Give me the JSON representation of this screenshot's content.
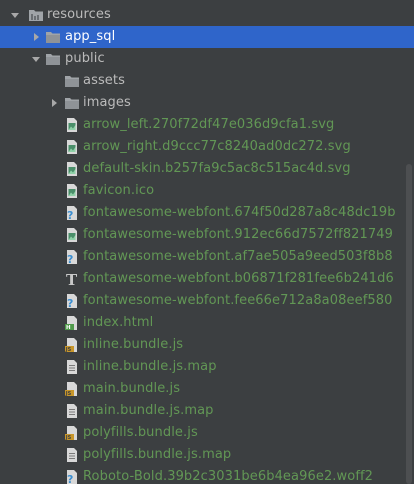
{
  "tree": {
    "items": [
      {
        "label": "resources",
        "kind": "folder",
        "expanded": true,
        "depth": 0,
        "icon": "folder-resources-icon"
      },
      {
        "label": "app_sql",
        "kind": "folder",
        "expanded": false,
        "depth": 1,
        "selected": true,
        "icon": "folder-icon"
      },
      {
        "label": "public",
        "kind": "folder",
        "expanded": true,
        "depth": 1,
        "icon": "folder-icon"
      },
      {
        "label": "assets",
        "kind": "folder",
        "expanded": null,
        "depth": 2,
        "icon": "folder-icon"
      },
      {
        "label": "images",
        "kind": "folder",
        "expanded": false,
        "depth": 2,
        "icon": "folder-icon"
      },
      {
        "label": "arrow_left.270f72df47e036d9cfa1.svg",
        "kind": "file",
        "depth": 2,
        "icon": "image-file-icon"
      },
      {
        "label": "arrow_right.d9ccc77c8240ad0dc272.svg",
        "kind": "file",
        "depth": 2,
        "icon": "image-file-icon"
      },
      {
        "label": "default-skin.b257fa9c5ac8c515ac4d.svg",
        "kind": "file",
        "depth": 2,
        "icon": "image-file-icon"
      },
      {
        "label": "favicon.ico",
        "kind": "file",
        "depth": 2,
        "icon": "image-file-icon"
      },
      {
        "label": "fontawesome-webfont.674f50d287a8c48dc19b",
        "kind": "file",
        "depth": 2,
        "icon": "unknown-file-icon"
      },
      {
        "label": "fontawesome-webfont.912ec66d7572ff821749",
        "kind": "file",
        "depth": 2,
        "icon": "image-file-icon"
      },
      {
        "label": "fontawesome-webfont.af7ae505a9eed503f8b8",
        "kind": "file",
        "depth": 2,
        "icon": "unknown-file-icon"
      },
      {
        "label": "fontawesome-webfont.b06871f281fee6b241d6",
        "kind": "file",
        "depth": 2,
        "icon": "font-file-icon"
      },
      {
        "label": "fontawesome-webfont.fee66e712a8a08eef580",
        "kind": "file",
        "depth": 2,
        "icon": "unknown-file-icon"
      },
      {
        "label": "index.html",
        "kind": "file",
        "depth": 2,
        "icon": "html-file-icon"
      },
      {
        "label": "inline.bundle.js",
        "kind": "file",
        "depth": 2,
        "icon": "js-file-icon"
      },
      {
        "label": "inline.bundle.js.map",
        "kind": "file",
        "depth": 2,
        "icon": "text-file-icon"
      },
      {
        "label": "main.bundle.js",
        "kind": "file",
        "depth": 2,
        "icon": "js-file-icon"
      },
      {
        "label": "main.bundle.js.map",
        "kind": "file",
        "depth": 2,
        "icon": "text-file-icon"
      },
      {
        "label": "polyfills.bundle.js",
        "kind": "file",
        "depth": 2,
        "icon": "js-file-icon"
      },
      {
        "label": "polyfills.bundle.js.map",
        "kind": "file",
        "depth": 2,
        "icon": "text-file-icon"
      },
      {
        "label": "Roboto-Bold.39b2c3031be6b4ea96e2.woff2",
        "kind": "file",
        "depth": 2,
        "icon": "unknown-file-icon"
      }
    ]
  },
  "colors": {
    "background": "#3c3f41",
    "selection": "#2f65ca",
    "folder_text": "#bbbbbb",
    "file_text": "#629755",
    "selected_text": "#ffffff"
  }
}
